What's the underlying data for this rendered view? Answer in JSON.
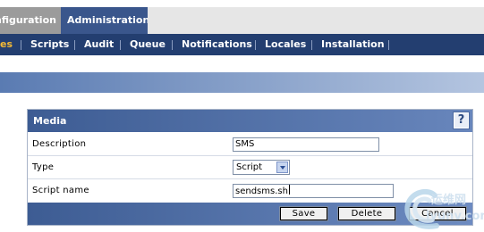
{
  "top_tabs": [
    {
      "label": "nfiguration",
      "active": false
    },
    {
      "label": "Administration",
      "active": true
    }
  ],
  "subnav": {
    "items": [
      {
        "label": "es",
        "active": true
      },
      {
        "label": "Scripts",
        "active": false
      },
      {
        "label": "Audit",
        "active": false
      },
      {
        "label": "Queue",
        "active": false
      },
      {
        "label": "Notifications",
        "active": false
      },
      {
        "label": "Locales",
        "active": false
      },
      {
        "label": "Installation",
        "active": false
      }
    ]
  },
  "form": {
    "title": "Media",
    "help_label": "?",
    "fields": {
      "description": {
        "label": "Description",
        "value": "SMS"
      },
      "type": {
        "label": "Type",
        "value": "Script"
      },
      "script_name": {
        "label": "Script name",
        "value": "sendsms.sh"
      }
    },
    "buttons": {
      "save": "Save",
      "delete": "Delete",
      "cancel": "Cancel"
    }
  },
  "watermark": {
    "line1": "运维网",
    "line2": "iyunv.com"
  },
  "colors": {
    "nav_dark": "#233e70",
    "tab_active": "#3a568c",
    "tab_inactive": "#9b9b9b",
    "subnav_active": "#f3b935",
    "form_header": "#3d5c93"
  },
  "icons": {
    "help": "help-icon",
    "dropdown": "chevron-down-icon"
  }
}
